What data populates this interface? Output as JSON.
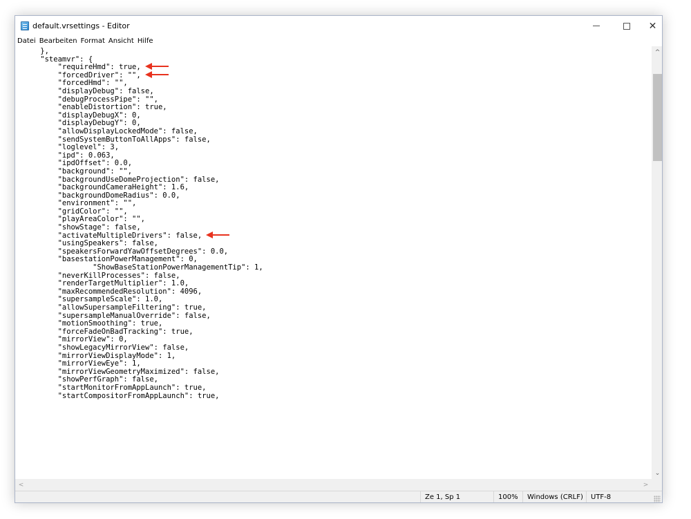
{
  "window": {
    "title": "default.vrsettings - Editor",
    "controls": {
      "minimize": "—",
      "maximize": "☐",
      "close": "✕"
    }
  },
  "menu": [
    "Datei",
    "Bearbeiten",
    "Format",
    "Ansicht",
    "Hilfe"
  ],
  "editor": {
    "lines": [
      {
        "text": "    },"
      },
      {
        "text": "    \"steamvr\": {"
      },
      {
        "text": "        \"requireHmd\": true,",
        "arrow": true
      },
      {
        "text": "        \"forcedDriver\": \"\",",
        "arrow": true
      },
      {
        "text": "        \"forcedHmd\": \"\","
      },
      {
        "text": "        \"displayDebug\": false,"
      },
      {
        "text": "        \"debugProcessPipe\": \"\","
      },
      {
        "text": "        \"enableDistortion\": true,"
      },
      {
        "text": "        \"displayDebugX\": 0,"
      },
      {
        "text": "        \"displayDebugY\": 0,"
      },
      {
        "text": "        \"allowDisplayLockedMode\": false,"
      },
      {
        "text": "        \"sendSystemButtonToAllApps\": false,"
      },
      {
        "text": "        \"loglevel\": 3,"
      },
      {
        "text": "        \"ipd\": 0.063,"
      },
      {
        "text": "        \"ipdOffset\": 0.0,"
      },
      {
        "text": "        \"background\": \"\","
      },
      {
        "text": "        \"backgroundUseDomeProjection\": false,"
      },
      {
        "text": "        \"backgroundCameraHeight\": 1.6,"
      },
      {
        "text": "        \"backgroundDomeRadius\": 0.0,"
      },
      {
        "text": "        \"environment\": \"\","
      },
      {
        "text": "        \"gridColor\": \"\","
      },
      {
        "text": "        \"playAreaColor\": \"\","
      },
      {
        "text": "        \"showStage\": false,"
      },
      {
        "text": "        \"activateMultipleDrivers\": false,",
        "arrow": true
      },
      {
        "text": "        \"usingSpeakers\": false,"
      },
      {
        "text": "        \"speakersForwardYawOffsetDegrees\": 0.0,"
      },
      {
        "text": "        \"basestationPowerManagement\": 0,"
      },
      {
        "text": "                \"ShowBaseStationPowerManagementTip\": 1,"
      },
      {
        "text": "        \"neverKillProcesses\": false,"
      },
      {
        "text": "        \"renderTargetMultiplier\": 1.0,"
      },
      {
        "text": "        \"maxRecommendedResolution\": 4096,"
      },
      {
        "text": "        \"supersampleScale\": 1.0,"
      },
      {
        "text": "        \"allowSupersampleFiltering\": true,"
      },
      {
        "text": "        \"supersampleManualOverride\": false,"
      },
      {
        "text": "        \"motionSmoothing\": true,"
      },
      {
        "text": "        \"forceFadeOnBadTracking\": true,"
      },
      {
        "text": "        \"mirrorView\": 0,"
      },
      {
        "text": "        \"showLegacyMirrorView\": false,"
      },
      {
        "text": "        \"mirrorViewDisplayMode\": 1,"
      },
      {
        "text": "        \"mirrorViewEye\": 1,"
      },
      {
        "text": "        \"mirrorViewGeometryMaximized\": false,"
      },
      {
        "text": "        \"showPerfGraph\": false,"
      },
      {
        "text": "        \"startMonitorFromAppLaunch\": true,"
      },
      {
        "text": "        \"startCompositorFromAppLaunch\": true,"
      }
    ]
  },
  "scrollbar": {
    "up": "^",
    "down": "⌄",
    "left": "<",
    "right": ">"
  },
  "status": {
    "position": "Ze 1, Sp 1",
    "zoom": "100%",
    "line_ending": "Windows (CRLF)",
    "encoding": "UTF-8"
  },
  "colors": {
    "annotation_arrow": "#e8321e"
  }
}
